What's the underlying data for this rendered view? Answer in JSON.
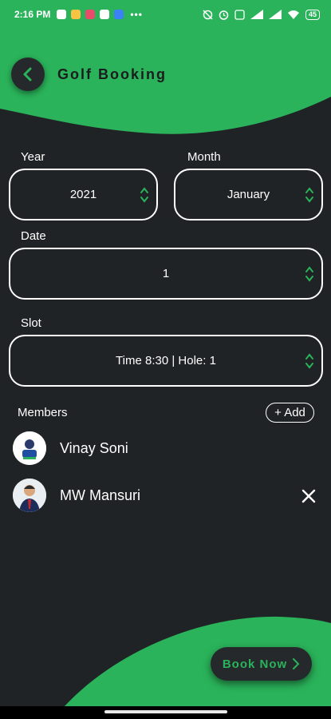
{
  "status_bar": {
    "time": "2:16 PM",
    "battery": "45"
  },
  "header": {
    "title": "Golf Booking"
  },
  "form": {
    "year": {
      "label": "Year",
      "value": "2021"
    },
    "month": {
      "label": "Month",
      "value": "January"
    },
    "date": {
      "label": "Date",
      "value": "1"
    },
    "slot": {
      "label": "Slot",
      "value": "Time 8:30 | Hole: 1"
    }
  },
  "members": {
    "label": "Members",
    "add_label": "+ Add",
    "items": [
      {
        "name": "Vinay Soni"
      },
      {
        "name": "MW Mansuri"
      }
    ]
  },
  "book_button": {
    "label": "Book Now"
  },
  "colors": {
    "accent": "#2ab35a",
    "background": "#202325",
    "surface": "#26292b"
  }
}
